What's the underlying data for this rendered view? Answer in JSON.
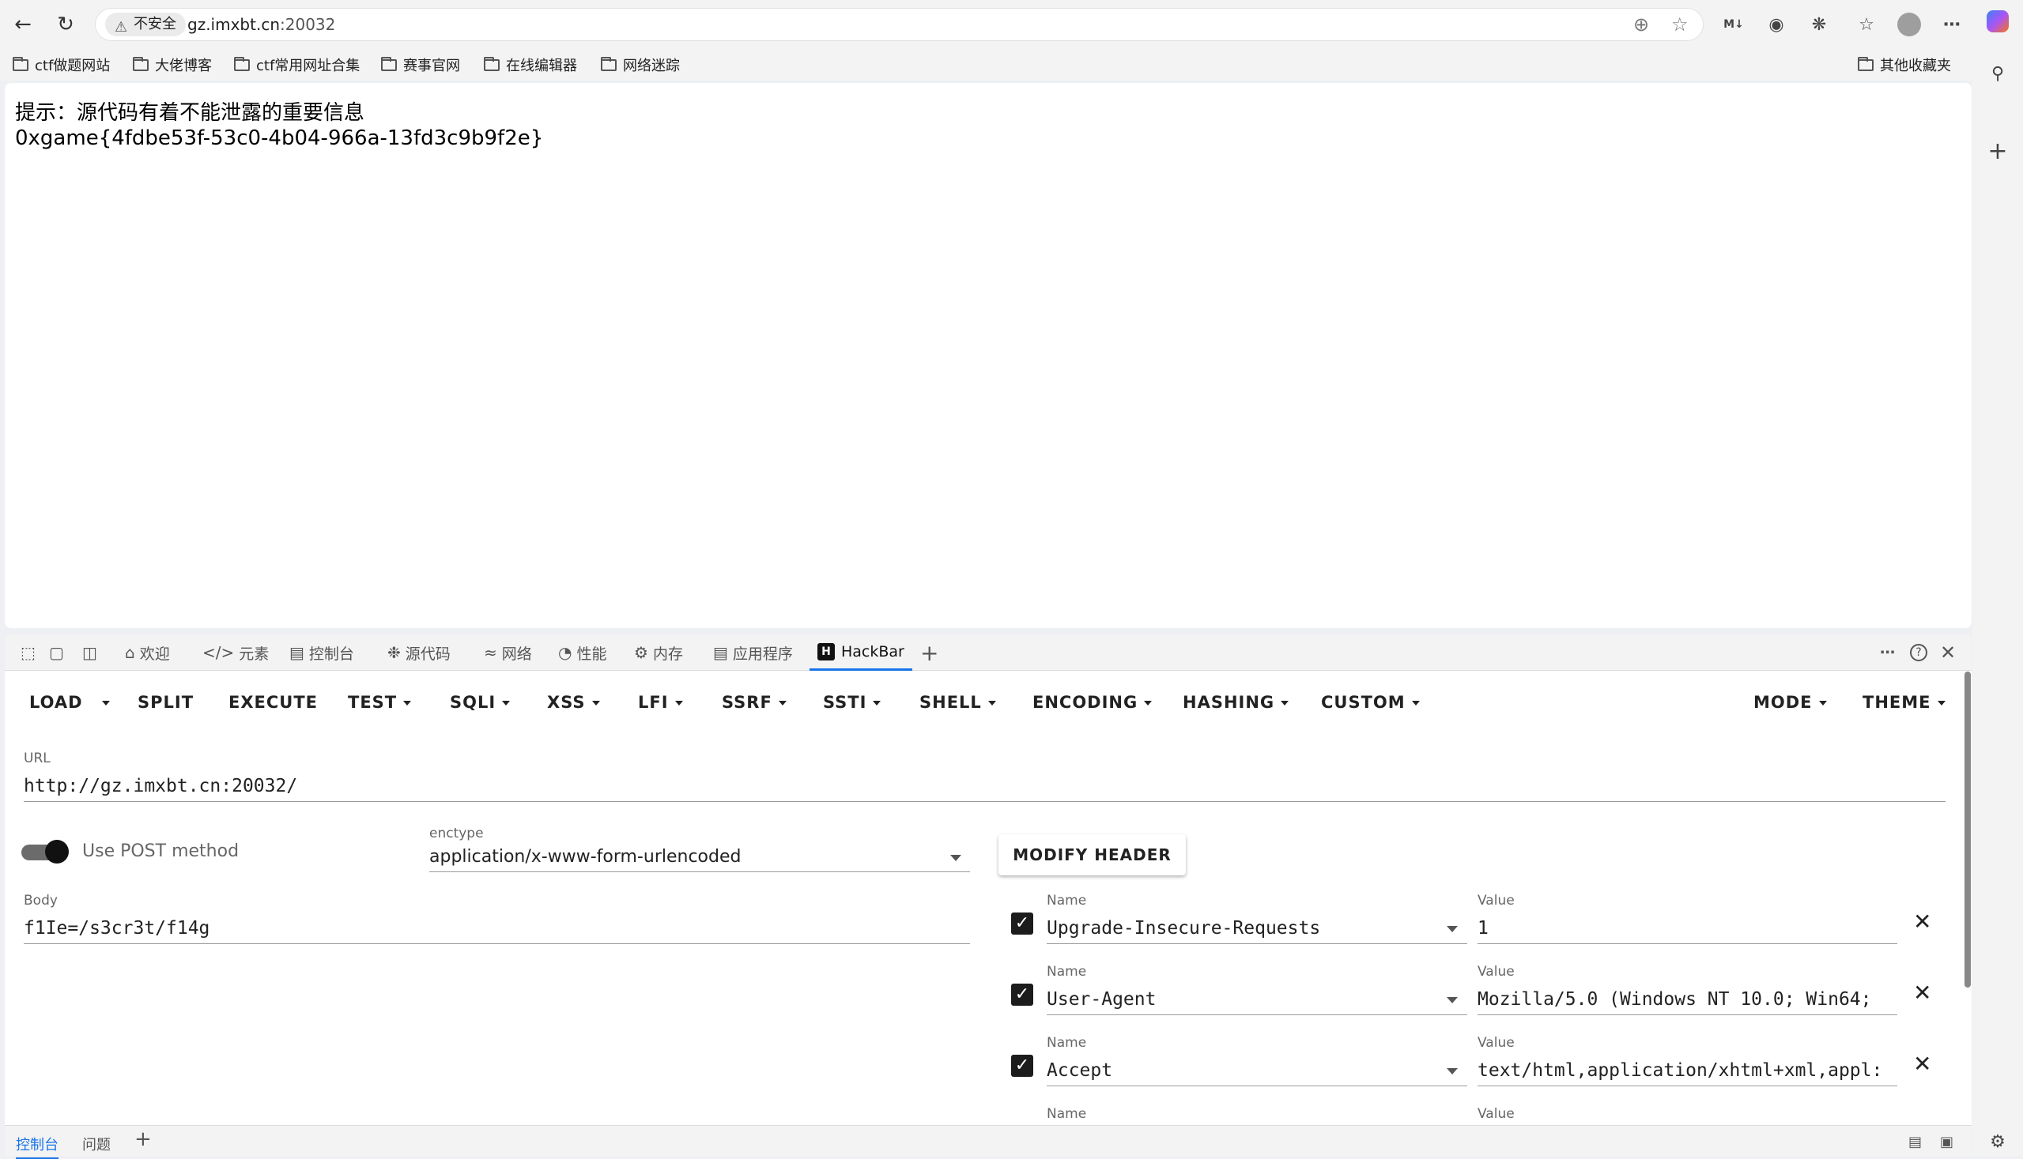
{
  "browser": {
    "security_label": "不安全",
    "url_host": "gz.imxbt.cn",
    "url_port": ":20032"
  },
  "bookmarks": [
    "ctf做题网站",
    "大佬博客",
    "ctf常用网址合集",
    "赛事官网",
    "在线编辑器",
    "网络迷踪"
  ],
  "other_bookmarks": "其他收藏夹",
  "page": {
    "hint": "提示：源代码有着不能泄露的重要信息",
    "flag": "0xgame{4fdbe53f-53c0-4b04-966a-13fd3c9b9f2e}"
  },
  "devtools": {
    "tabs": [
      "欢迎",
      "元素",
      "控制台",
      "源代码",
      "网络",
      "性能",
      "内存",
      "应用程序",
      "HackBar"
    ],
    "active_tab": "HackBar"
  },
  "hackbar": {
    "buttons": [
      "LOAD",
      "SPLIT",
      "EXECUTE",
      "TEST",
      "SQLI",
      "XSS",
      "LFI",
      "SSRF",
      "SSTI",
      "SHELL",
      "ENCODING",
      "HASHING",
      "CUSTOM"
    ],
    "mode": "MODE",
    "theme": "THEME",
    "url_label": "URL",
    "url_value": "http://gz.imxbt.cn:20032/",
    "post_label": "Use POST method",
    "post_enabled": true,
    "enctype_label": "enctype",
    "enctype_value": "application/x-www-form-urlencoded",
    "body_label": "Body",
    "body_value": "f1Ie=/s3cr3t/f14g",
    "modify_header": "MODIFY HEADER",
    "name_label": "Name",
    "value_label": "Value",
    "headers": [
      {
        "name": "Upgrade-Insecure-Requests",
        "value": "1",
        "checked": true
      },
      {
        "name": "User-Agent",
        "value": "Mozilla/5.0 (Windows NT 10.0; Win64;",
        "checked": true
      },
      {
        "name": "Accept",
        "value": "text/html,application/xhtml+xml,appl:",
        "checked": true
      }
    ]
  },
  "statusbar": {
    "console": "控制台",
    "issues": "问题"
  }
}
